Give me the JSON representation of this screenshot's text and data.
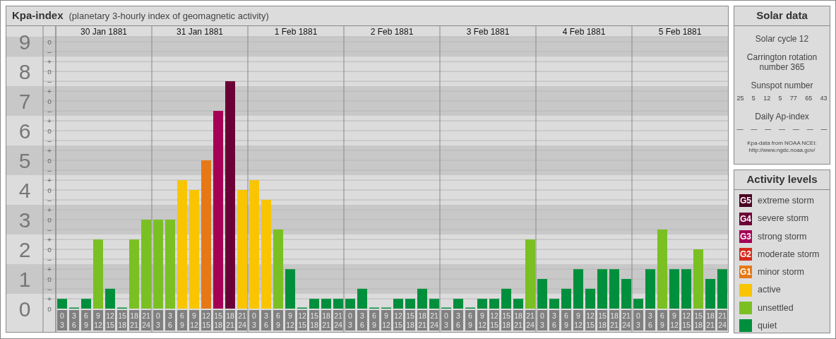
{
  "chart": {
    "title": "Kpa-index",
    "subtitle": "(planetary 3-hourly index of geomagnetic activity)",
    "day_labels": [
      "30 Jan 1881",
      "31 Jan 1881",
      "1 Feb 1881",
      "2 Feb 1881",
      "3 Feb 1881",
      "4 Feb 1881",
      "5 Feb 1881"
    ],
    "minor_tick_labels": [
      "o",
      "–",
      "+",
      "o",
      "–",
      "+",
      "o",
      "–",
      "+",
      "o",
      "–",
      "+",
      "o",
      "–",
      "+",
      "o",
      "–",
      "+",
      "o",
      "–",
      "+",
      "o",
      "–",
      "+",
      "o",
      "–",
      "+",
      "o"
    ],
    "chart_data": {
      "type": "bar",
      "stacked": true,
      "grid": true,
      "ylim": [
        0,
        9.17
      ],
      "yticks": [
        9,
        8,
        7,
        6,
        5,
        4,
        3,
        2,
        1,
        0
      ],
      "categories": [
        "0 3",
        "3 6",
        "6 9",
        "9 12",
        "12 15",
        "15 18",
        "18 21",
        "21 24",
        "0 3",
        "3 6",
        "6 9",
        "9 12",
        "12 15",
        "15 18",
        "18 21",
        "21 24",
        "0 3",
        "3 6",
        "6 9",
        "9 12",
        "12 15",
        "15 18",
        "18 21",
        "21 24",
        "0 3",
        "3 6",
        "6 9",
        "9 12",
        "12 15",
        "15 18",
        "18 21",
        "21 24",
        "0 3",
        "3 6",
        "6 9",
        "9 12",
        "12 15",
        "15 18",
        "18 21",
        "21 24",
        "0 3",
        "3 6",
        "6 9",
        "9 12",
        "12 15",
        "15 18",
        "18 21",
        "21 24",
        "0 3",
        "3 6",
        "6 9",
        "9 12",
        "12 15",
        "15 18",
        "18 21",
        "21 24"
      ],
      "series": [
        {
          "color": "#008f3c",
          "values": [
            0.33,
            0,
            0.33,
            null,
            0.67,
            0,
            null,
            null,
            null,
            null,
            null,
            null,
            null,
            null,
            null,
            null,
            null,
            null,
            null,
            1.33,
            0,
            0.33,
            0.33,
            0.33,
            0.33,
            0.67,
            0,
            0,
            0.33,
            0.33,
            0.67,
            0.33,
            0,
            0.33,
            0,
            0.33,
            0.33,
            0.67,
            0.33,
            null,
            1,
            0.33,
            0.67,
            1.33,
            0.67,
            1.33,
            1.33,
            1,
            0.33,
            1.33,
            null,
            1.33,
            1.33,
            null,
            1,
            1.33
          ]
        },
        {
          "color": "#7ac022",
          "values": [
            null,
            null,
            null,
            2.33,
            null,
            null,
            2.33,
            3,
            3,
            3,
            null,
            null,
            null,
            null,
            null,
            null,
            null,
            null,
            2.67,
            null,
            null,
            null,
            null,
            null,
            null,
            null,
            null,
            null,
            null,
            null,
            null,
            null,
            null,
            null,
            null,
            null,
            null,
            null,
            null,
            2.33,
            null,
            null,
            null,
            null,
            null,
            null,
            null,
            null,
            null,
            null,
            2.67,
            null,
            null,
            2,
            null,
            null
          ]
        },
        {
          "color": "#f8c500",
          "values": [
            null,
            null,
            null,
            null,
            null,
            null,
            null,
            null,
            null,
            null,
            4.33,
            4,
            null,
            null,
            null,
            4,
            4.33,
            3.67,
            null,
            null,
            null,
            null,
            null,
            null,
            null,
            null,
            null,
            null,
            null,
            null,
            null,
            null,
            null,
            null,
            null,
            null,
            null,
            null,
            null,
            null,
            null,
            null,
            null,
            null,
            null,
            null,
            null,
            null,
            null,
            null,
            null,
            null,
            null,
            null,
            null,
            null
          ]
        },
        {
          "color": "#e67817",
          "values": [
            null,
            null,
            null,
            null,
            null,
            null,
            null,
            null,
            null,
            null,
            null,
            null,
            5,
            null,
            null,
            null,
            null,
            null,
            null,
            null,
            null,
            null,
            null,
            null,
            null,
            null,
            null,
            null,
            null,
            null,
            null,
            null,
            null,
            null,
            null,
            null,
            null,
            null,
            null,
            null,
            null,
            null,
            null,
            null,
            null,
            null,
            null,
            null,
            null,
            null,
            null,
            null,
            null,
            null,
            null,
            null
          ]
        },
        {
          "color": "#a50056",
          "values": [
            null,
            null,
            null,
            null,
            null,
            null,
            null,
            null,
            null,
            null,
            null,
            null,
            null,
            6.67,
            null,
            null,
            null,
            null,
            null,
            null,
            null,
            null,
            null,
            null,
            null,
            null,
            null,
            null,
            null,
            null,
            null,
            null,
            null,
            null,
            null,
            null,
            null,
            null,
            null,
            null,
            null,
            null,
            null,
            null,
            null,
            null,
            null,
            null,
            null,
            null,
            null,
            null,
            null,
            null,
            null,
            null
          ]
        },
        {
          "color": "#6b0037",
          "values": [
            null,
            null,
            null,
            null,
            null,
            null,
            null,
            null,
            null,
            null,
            null,
            null,
            null,
            null,
            7.67,
            null,
            null,
            null,
            null,
            null,
            null,
            null,
            null,
            null,
            null,
            null,
            null,
            null,
            null,
            null,
            null,
            null,
            null,
            null,
            null,
            null,
            null,
            null,
            null,
            null,
            null,
            null,
            null,
            null,
            null,
            null,
            null,
            null,
            null,
            null,
            null,
            null,
            null,
            null,
            null,
            null
          ]
        }
      ]
    }
  },
  "solar_data": {
    "title": "Solar data",
    "solar_cycle": "Solar cycle 12",
    "carrington": "Carrington rotation number 365",
    "sunspot_title": "Sunspot number",
    "sunspot_numbers": [
      "25",
      "5",
      "12",
      "5",
      "77",
      "65",
      "43"
    ],
    "ap_title": "Daily Ap-index",
    "ap_values": [
      "—",
      "—",
      "—",
      "—",
      "—",
      "—",
      "—"
    ],
    "source": "Kpa-data from NOAA NCEI:",
    "source_url": "http://www.ngdc.noaa.gov/"
  },
  "activity_levels": {
    "title": "Activity levels",
    "items": [
      {
        "badge": "G5",
        "label": "extreme storm",
        "color": "#4b0022"
      },
      {
        "badge": "G4",
        "label": "severe storm",
        "color": "#6b0037"
      },
      {
        "badge": "G3",
        "label": "strong storm",
        "color": "#a50056"
      },
      {
        "badge": "G2",
        "label": "moderate storm",
        "color": "#d52b1e"
      },
      {
        "badge": "G1",
        "label": "minor storm",
        "color": "#e67817"
      },
      {
        "label": "active",
        "color": "#f8c500"
      },
      {
        "label": "unsettled",
        "color": "#7ac022"
      },
      {
        "label": "quiet",
        "color": "#008f3c"
      }
    ]
  }
}
